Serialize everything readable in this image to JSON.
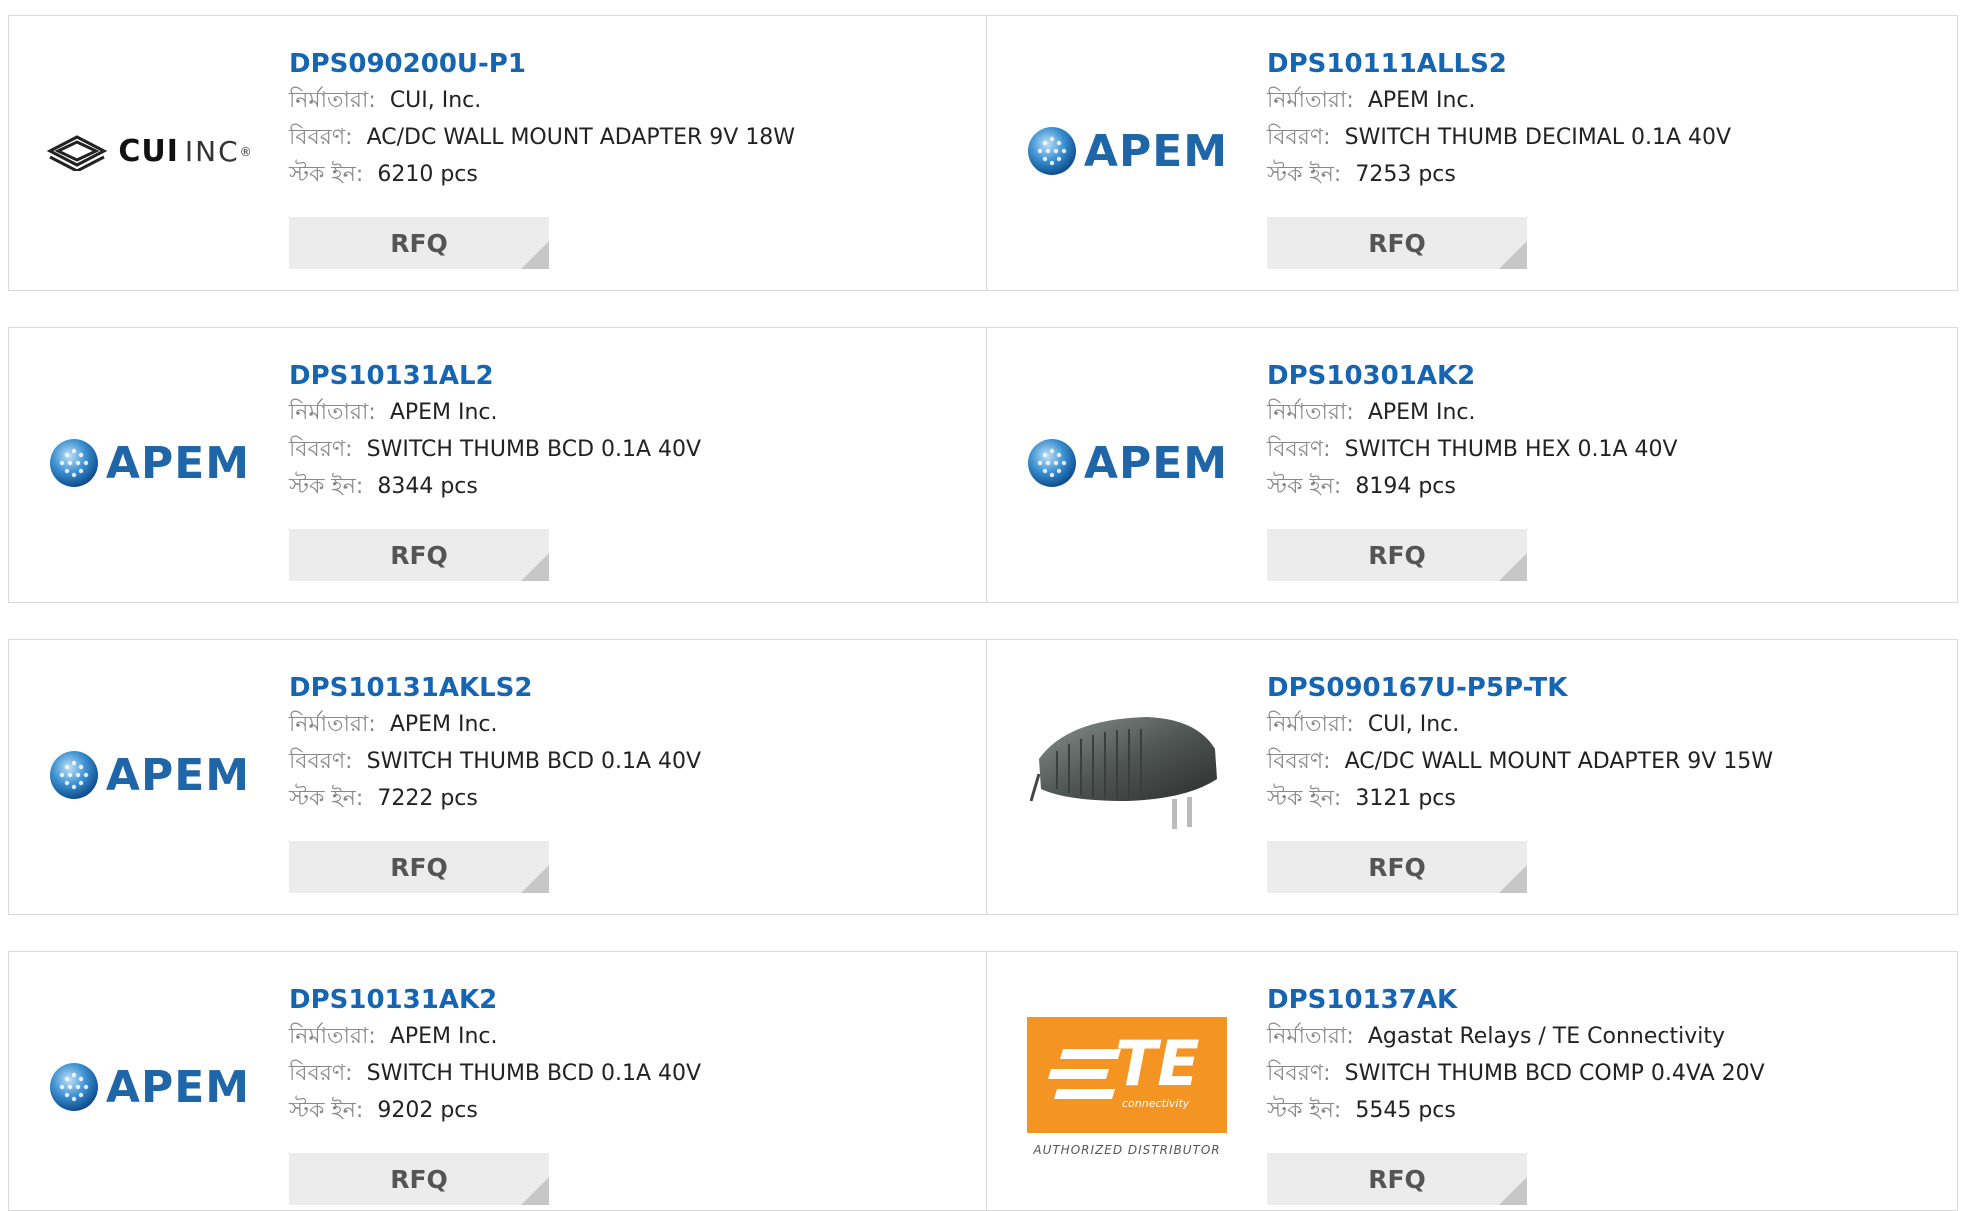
{
  "labels": {
    "manufacturer": "নির্মাতারা:",
    "description": "বিবরণ:",
    "stock": "স্টক ইন:",
    "rfq": "RFQ"
  },
  "colors": {
    "link": "#1565b3",
    "border": "#d9d9d9",
    "rfq_bg": "#ececec",
    "apem_blue": "#1f66a8",
    "te_orange": "#f39423"
  },
  "products": [
    {
      "part": "DPS090200U-P1",
      "manufacturer": "CUI, Inc.",
      "description": "AC/DC WALL MOUNT ADAPTER 9V 18W",
      "stock": "6210 pcs",
      "logo": "cui"
    },
    {
      "part": "DPS10111ALLS2",
      "manufacturer": "APEM Inc.",
      "description": "SWITCH THUMB DECIMAL 0.1A 40V",
      "stock": "7253 pcs",
      "logo": "apem"
    },
    {
      "part": "DPS10131AL2",
      "manufacturer": "APEM Inc.",
      "description": "SWITCH THUMB BCD 0.1A 40V",
      "stock": "8344 pcs",
      "logo": "apem"
    },
    {
      "part": "DPS10301AK2",
      "manufacturer": "APEM Inc.",
      "description": "SWITCH THUMB HEX 0.1A 40V",
      "stock": "8194 pcs",
      "logo": "apem"
    },
    {
      "part": "DPS10131AKLS2",
      "manufacturer": "APEM Inc.",
      "description": "SWITCH THUMB BCD 0.1A 40V",
      "stock": "7222 pcs",
      "logo": "apem"
    },
    {
      "part": "DPS090167U-P5P-TK",
      "manufacturer": "CUI, Inc.",
      "description": "AC/DC WALL MOUNT ADAPTER 9V 15W",
      "stock": "3121 pcs",
      "logo": "adapter-photo"
    },
    {
      "part": "DPS10131AK2",
      "manufacturer": "APEM Inc.",
      "description": "SWITCH THUMB BCD 0.1A 40V",
      "stock": "9202 pcs",
      "logo": "apem"
    },
    {
      "part": "DPS10137AK",
      "manufacturer": "Agastat Relays / TE Connectivity",
      "description": "SWITCH THUMB BCD COMP 0.4VA 20V",
      "stock": "5545 pcs",
      "logo": "te"
    }
  ],
  "logos": {
    "cui_bold": "CUI",
    "cui_thin": "INC",
    "cui_reg": "®",
    "apem": "APEM",
    "te_mark": "TE",
    "te_sub": "connectivity",
    "te_dist": "AUTHORIZED DISTRIBUTOR"
  }
}
